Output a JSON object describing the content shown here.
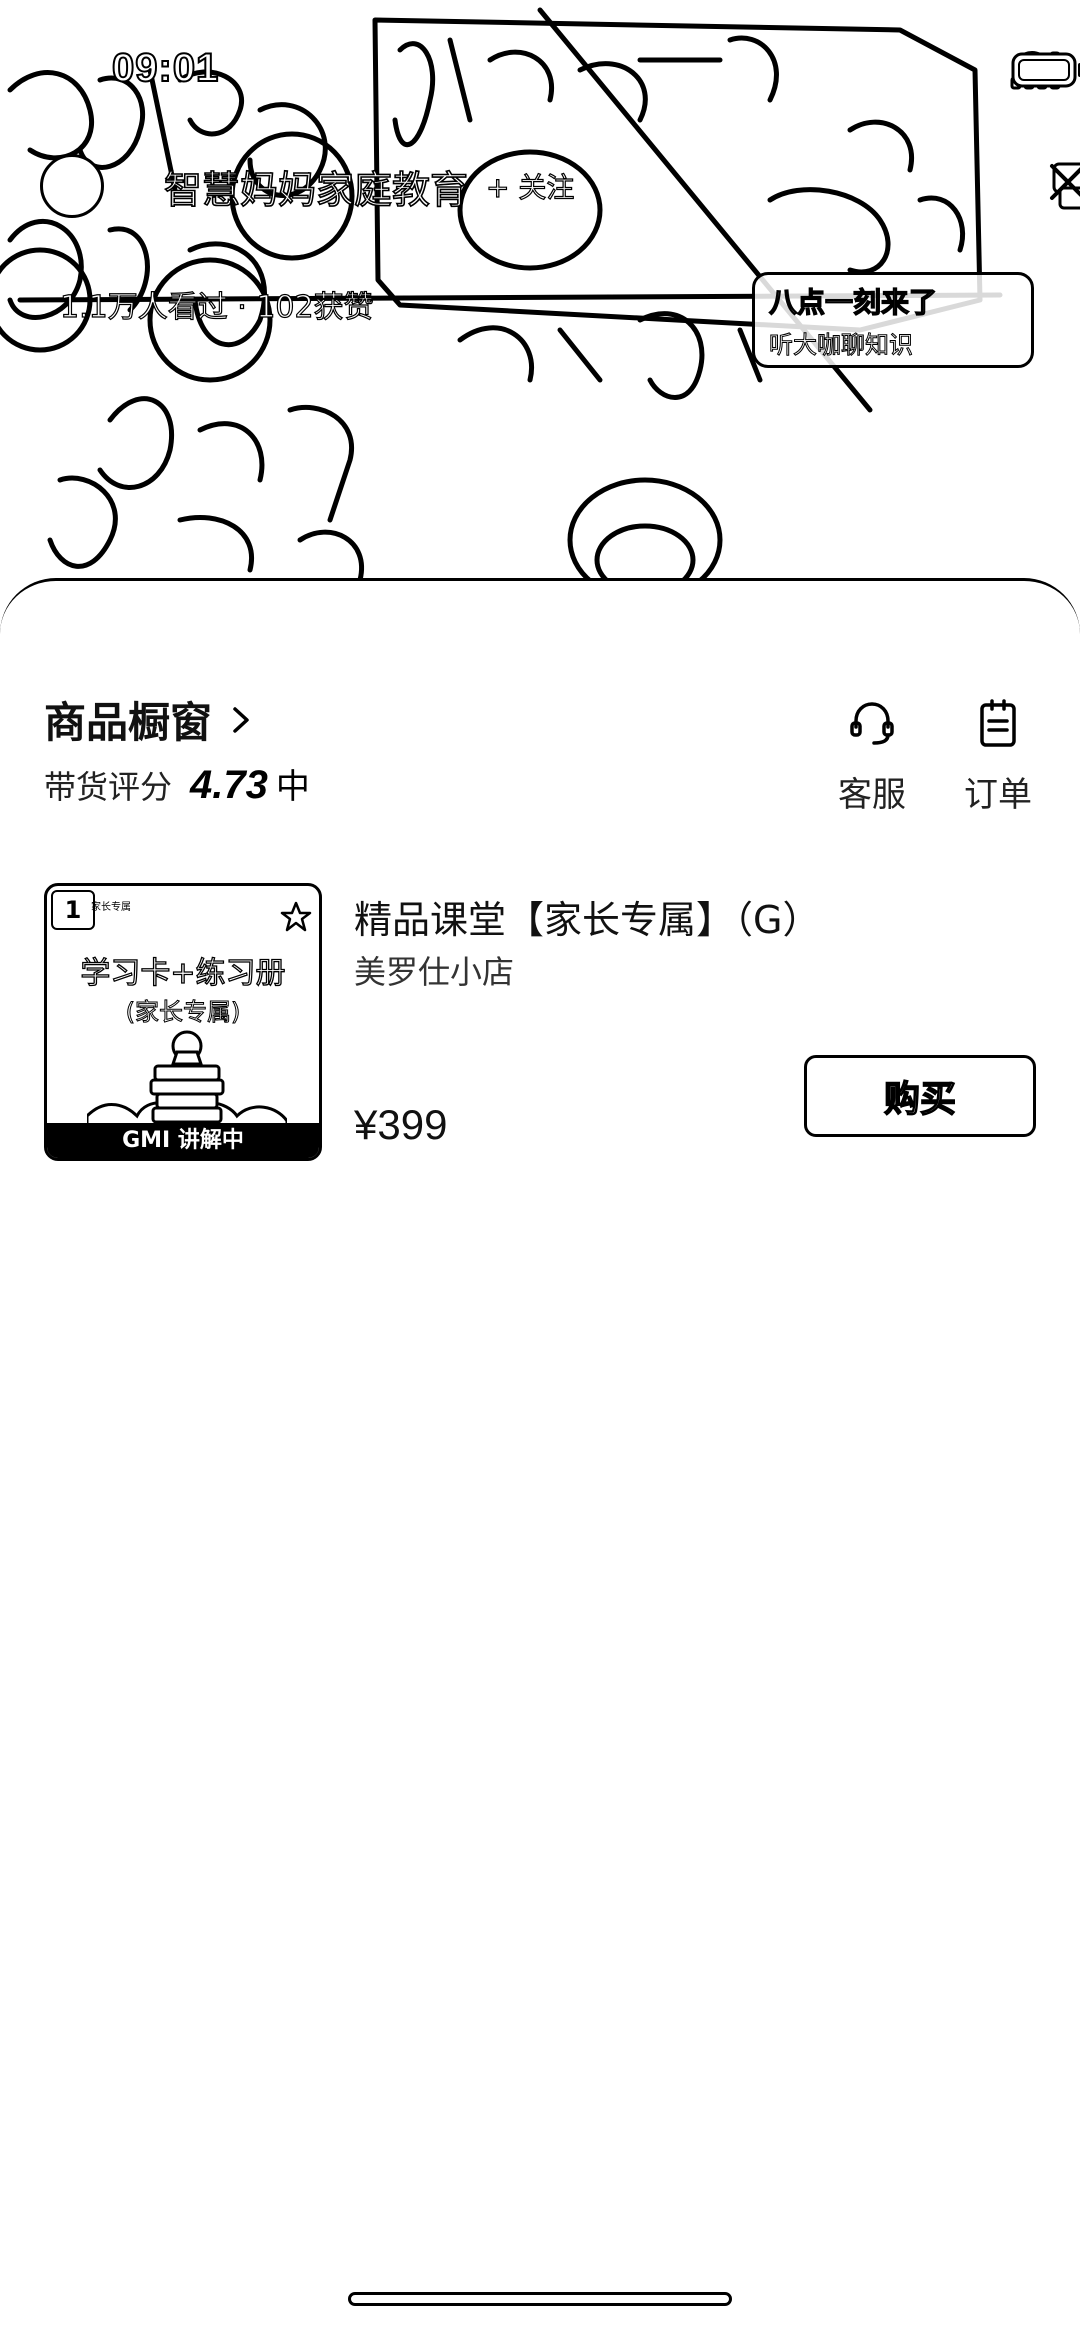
{
  "status_bar": {
    "time": "09:01"
  },
  "live": {
    "anchor_name": "智慧妈妈家庭教育",
    "follow_label": "+ 关注",
    "viewers_text": "1.1万人看过 · 102获赞",
    "promo_line1": "八点一刻来了",
    "promo_line2": "听大咖聊知识"
  },
  "sheet": {
    "title": "商品橱窗",
    "rating_label": "带货评分",
    "rating_value": "4.73",
    "rating_level": "中",
    "actions": {
      "service": "客服",
      "orders": "订单"
    }
  },
  "product": {
    "badge": "1",
    "thumb_tag": "家长专属",
    "thumb_title": "学习卡+练习册",
    "thumb_sub": "(家长专属)",
    "thumb_bottom": "GMI 讲解中",
    "title": "精品课堂【家长专属】（G）",
    "shop": "美罗仕小店",
    "price": "¥399",
    "buy_label": "购买"
  }
}
